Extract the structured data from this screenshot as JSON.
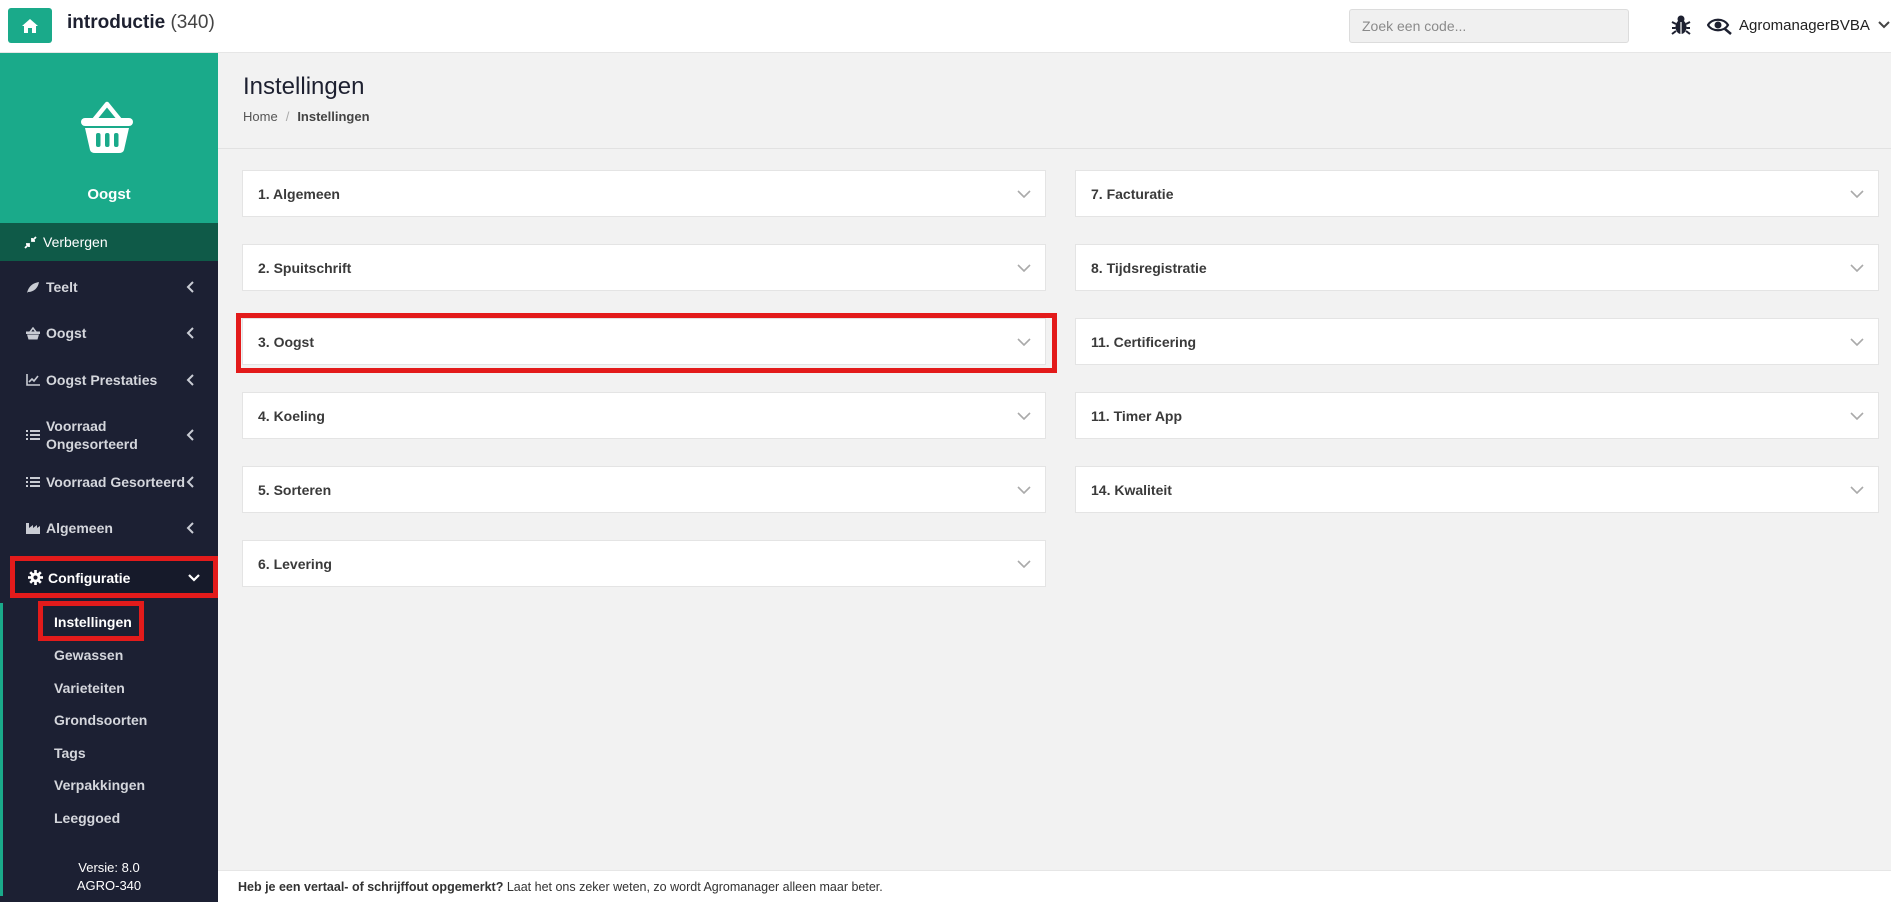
{
  "header": {
    "title": "introductie",
    "count": "(340)",
    "search_placeholder": "Zoek een code...",
    "user_name": "AgromanagerBVBA"
  },
  "sidebar": {
    "module": "Oogst",
    "hide_label": "Verbergen",
    "items": [
      {
        "label": "Teelt",
        "icon": "leaf-icon"
      },
      {
        "label": "Oogst",
        "icon": "basket-icon"
      },
      {
        "label": "Oogst Prestaties",
        "icon": "chart-line-icon"
      },
      {
        "label": "Voorraad Ongesorteerd",
        "icon": "list-icon"
      },
      {
        "label": "Voorraad Gesorteerd",
        "icon": "list-icon"
      },
      {
        "label": "Algemeen",
        "icon": "industry-icon"
      }
    ],
    "config_label": "Configuratie",
    "sub_items": [
      "Instellingen",
      "Gewassen",
      "Varieteiten",
      "Grondsoorten",
      "Tags",
      "Verpakkingen",
      "Leeggoed"
    ],
    "version_line1": "Versie: 8.0",
    "version_line2": "AGRO-340"
  },
  "page": {
    "title": "Instellingen",
    "breadcrumb_home": "Home",
    "breadcrumb_current": "Instellingen"
  },
  "panels_left": [
    "1. Algemeen",
    "2. Spuitschrift",
    "3. Oogst",
    "4. Koeling",
    "5. Sorteren",
    "6. Levering"
  ],
  "panels_right": [
    "7. Facturatie",
    "8. Tijdsregistratie",
    "11. Certificering",
    "11. Timer App",
    "14. Kwaliteit"
  ],
  "footer": {
    "bold": "Heb je een vertaal- of schrijffout opgemerkt?",
    "text": " Laat het ons zeker weten, zo wordt Agromanager alleen maar beter."
  },
  "colors": {
    "brand": "#1aaa8a",
    "sidebar_bg": "#1c2033",
    "highlight": "#e31b1b"
  }
}
